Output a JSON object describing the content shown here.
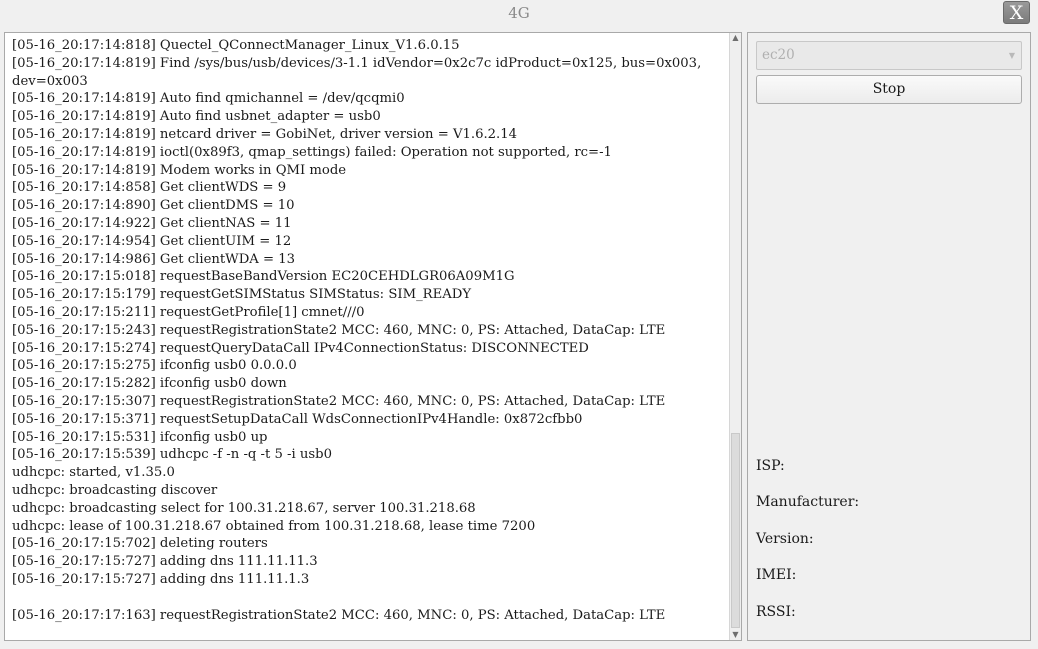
{
  "window": {
    "title": "4G",
    "close_label": "X"
  },
  "log": {
    "lines": [
      "[05-16_20:17:14:818] Quectel_QConnectManager_Linux_V1.6.0.15",
      "[05-16_20:17:14:819] Find /sys/bus/usb/devices/3-1.1 idVendor=0x2c7c idProduct=0x125, bus=0x003,",
      "dev=0x003",
      "[05-16_20:17:14:819] Auto find qmichannel = /dev/qcqmi0",
      "[05-16_20:17:14:819] Auto find usbnet_adapter = usb0",
      "[05-16_20:17:14:819] netcard driver = GobiNet, driver version = V1.6.2.14",
      "[05-16_20:17:14:819] ioctl(0x89f3, qmap_settings) failed: Operation not supported, rc=-1",
      "[05-16_20:17:14:819] Modem works in QMI mode",
      "[05-16_20:17:14:858] Get clientWDS = 9",
      "[05-16_20:17:14:890] Get clientDMS = 10",
      "[05-16_20:17:14:922] Get clientNAS = 11",
      "[05-16_20:17:14:954] Get clientUIM = 12",
      "[05-16_20:17:14:986] Get clientWDA = 13",
      "[05-16_20:17:15:018] requestBaseBandVersion EC20CEHDLGR06A09M1G",
      "[05-16_20:17:15:179] requestGetSIMStatus SIMStatus: SIM_READY",
      "[05-16_20:17:15:211] requestGetProfile[1] cmnet///0",
      "[05-16_20:17:15:243] requestRegistrationState2 MCC: 460, MNC: 0, PS: Attached, DataCap: LTE",
      "[05-16_20:17:15:274] requestQueryDataCall IPv4ConnectionStatus: DISCONNECTED",
      "[05-16_20:17:15:275] ifconfig usb0 0.0.0.0",
      "[05-16_20:17:15:282] ifconfig usb0 down",
      "[05-16_20:17:15:307] requestRegistrationState2 MCC: 460, MNC: 0, PS: Attached, DataCap: LTE",
      "[05-16_20:17:15:371] requestSetupDataCall WdsConnectionIPv4Handle: 0x872cfbb0",
      "[05-16_20:17:15:531] ifconfig usb0 up",
      "[05-16_20:17:15:539] udhcpc -f -n -q -t 5 -i usb0",
      "udhcpc: started, v1.35.0",
      "udhcpc: broadcasting discover",
      "udhcpc: broadcasting select for 100.31.218.67, server 100.31.218.68",
      "udhcpc: lease of 100.31.218.67 obtained from 100.31.218.68, lease time 7200",
      "[05-16_20:17:15:702] deleting routers",
      "[05-16_20:17:15:727] adding dns 111.11.11.3",
      "[05-16_20:17:15:727] adding dns 111.11.1.3",
      "",
      "[05-16_20:17:17:163] requestRegistrationState2 MCC: 460, MNC: 0, PS: Attached, DataCap: LTE"
    ]
  },
  "controls": {
    "device_value": "ec20",
    "stop_label": "Stop"
  },
  "info": {
    "isp_label": "ISP:",
    "manufacturer_label": "Manufacturer:",
    "version_label": "Version:",
    "imei_label": "IMEI:",
    "rssi_label": "RSSI:"
  },
  "icons": {
    "scroll_up": "up-arrow",
    "scroll_down": "down-arrow",
    "dropdown": "chevron-down"
  }
}
